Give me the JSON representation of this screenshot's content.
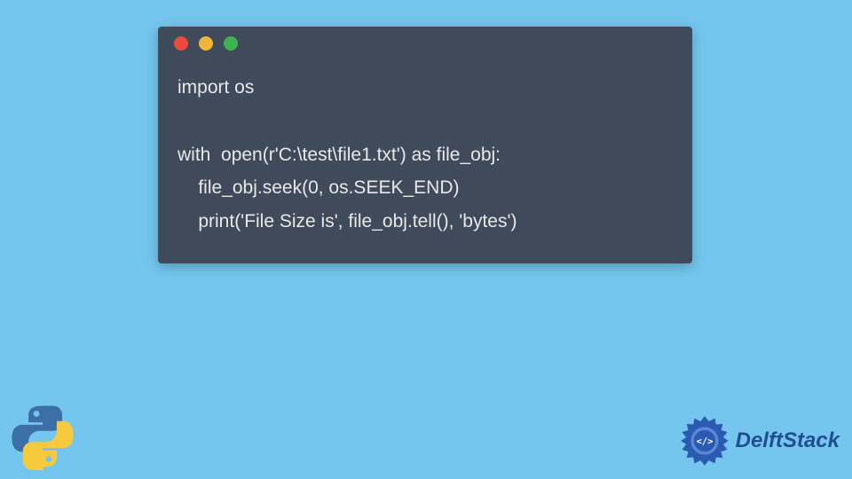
{
  "code": {
    "line1": "import os",
    "line2": "",
    "line3": "with  open(r'C:\\test\\file1.txt') as file_obj:",
    "line4": "    file_obj.seek(0, os.SEEK_END)",
    "line5": "    print('File Size is', file_obj.tell(), 'bytes')"
  },
  "brand": {
    "name": "DelftStack"
  }
}
